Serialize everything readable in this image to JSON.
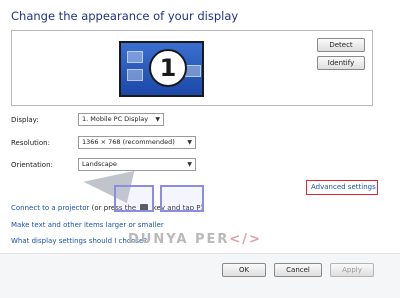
{
  "window": {
    "title": "Change the appearance of your display"
  },
  "preview": {
    "monitor_number": "1",
    "detect_label": "Detect",
    "identify_label": "Identify"
  },
  "settings": {
    "display": {
      "label": "Display:",
      "value": "1. Mobile PC Display"
    },
    "resolution": {
      "label": "Resolution:",
      "value": "1366 × 768 (recommended)"
    },
    "orientation": {
      "label": "Orientation:",
      "value": "Landscape"
    },
    "advanced_link": "Advanced settings",
    "advanced_highlight_color": "#e0262a"
  },
  "links": {
    "projector_link": "Connect to a projector",
    "projector_hint_start": "(or press the",
    "projector_hint_end": "key and tap P)",
    "text_size_link": "Make text and other items larger or smaller",
    "choose_link": "What display settings should I choose?"
  },
  "footer": {
    "ok_label": "OK",
    "cancel_label": "Cancel",
    "apply_label": "Apply"
  },
  "watermark": {
    "text_main": "DUNYA PER",
    "text_code": "</>"
  },
  "icons": {
    "windows_key": "windows-key-icon",
    "dropdown": "chevron-down-icon"
  },
  "colors": {
    "title": "#1e3287",
    "link": "#1a52b0",
    "monitor": "#2a5ec0"
  }
}
